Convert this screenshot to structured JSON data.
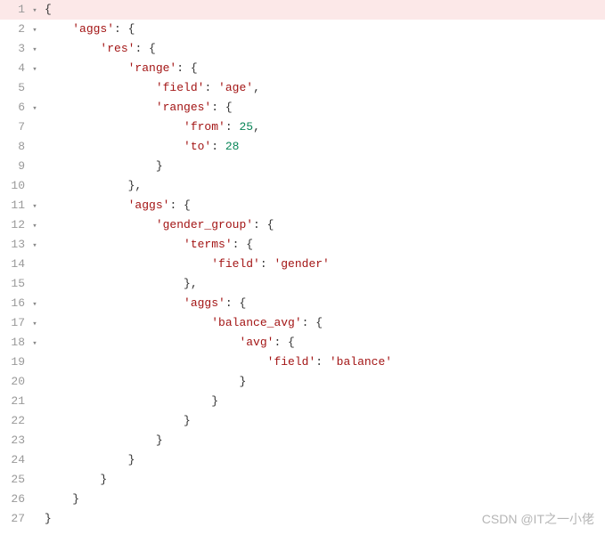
{
  "watermark": "CSDN @IT之一小佬",
  "lines": [
    {
      "num": "1",
      "fold": "▾",
      "hl": true,
      "indent": "",
      "tokens": [
        [
          "punct",
          "{"
        ]
      ]
    },
    {
      "num": "2",
      "fold": "▾",
      "hl": false,
      "indent": "    ",
      "tokens": [
        [
          "key",
          "'aggs'"
        ],
        [
          "punct",
          ": {"
        ]
      ]
    },
    {
      "num": "3",
      "fold": "▾",
      "hl": false,
      "indent": "        ",
      "tokens": [
        [
          "key",
          "'res'"
        ],
        [
          "punct",
          ": {"
        ]
      ]
    },
    {
      "num": "4",
      "fold": "▾",
      "hl": false,
      "indent": "            ",
      "tokens": [
        [
          "key",
          "'range'"
        ],
        [
          "punct",
          ": {"
        ]
      ]
    },
    {
      "num": "5",
      "fold": "",
      "hl": false,
      "indent": "                ",
      "tokens": [
        [
          "key",
          "'field'"
        ],
        [
          "punct",
          ": "
        ],
        [
          "key",
          "'age'"
        ],
        [
          "punct",
          ","
        ]
      ]
    },
    {
      "num": "6",
      "fold": "▾",
      "hl": false,
      "indent": "                ",
      "tokens": [
        [
          "key",
          "'ranges'"
        ],
        [
          "punct",
          ": {"
        ]
      ]
    },
    {
      "num": "7",
      "fold": "",
      "hl": false,
      "indent": "                    ",
      "tokens": [
        [
          "key",
          "'from'"
        ],
        [
          "punct",
          ": "
        ],
        [
          "num",
          "25"
        ],
        [
          "punct",
          ","
        ]
      ]
    },
    {
      "num": "8",
      "fold": "",
      "hl": false,
      "indent": "                    ",
      "tokens": [
        [
          "key",
          "'to'"
        ],
        [
          "punct",
          ": "
        ],
        [
          "num",
          "28"
        ]
      ]
    },
    {
      "num": "9",
      "fold": "",
      "hl": false,
      "indent": "                ",
      "tokens": [
        [
          "punct",
          "}"
        ]
      ]
    },
    {
      "num": "10",
      "fold": "",
      "hl": false,
      "indent": "            ",
      "tokens": [
        [
          "punct",
          "},"
        ]
      ]
    },
    {
      "num": "11",
      "fold": "▾",
      "hl": false,
      "indent": "            ",
      "tokens": [
        [
          "key",
          "'aggs'"
        ],
        [
          "punct",
          ": {"
        ]
      ]
    },
    {
      "num": "12",
      "fold": "▾",
      "hl": false,
      "indent": "                ",
      "tokens": [
        [
          "key",
          "'gender_group'"
        ],
        [
          "punct",
          ": {"
        ]
      ]
    },
    {
      "num": "13",
      "fold": "▾",
      "hl": false,
      "indent": "                    ",
      "tokens": [
        [
          "key",
          "'terms'"
        ],
        [
          "punct",
          ": {"
        ]
      ]
    },
    {
      "num": "14",
      "fold": "",
      "hl": false,
      "indent": "                        ",
      "tokens": [
        [
          "key",
          "'field'"
        ],
        [
          "punct",
          ": "
        ],
        [
          "key",
          "'gender'"
        ]
      ]
    },
    {
      "num": "15",
      "fold": "",
      "hl": false,
      "indent": "                    ",
      "tokens": [
        [
          "punct",
          "},"
        ]
      ]
    },
    {
      "num": "16",
      "fold": "▾",
      "hl": false,
      "indent": "                    ",
      "tokens": [
        [
          "key",
          "'aggs'"
        ],
        [
          "punct",
          ": {"
        ]
      ]
    },
    {
      "num": "17",
      "fold": "▾",
      "hl": false,
      "indent": "                        ",
      "tokens": [
        [
          "key",
          "'balance_avg'"
        ],
        [
          "punct",
          ": {"
        ]
      ]
    },
    {
      "num": "18",
      "fold": "▾",
      "hl": false,
      "indent": "                            ",
      "tokens": [
        [
          "key",
          "'avg'"
        ],
        [
          "punct",
          ": {"
        ]
      ]
    },
    {
      "num": "19",
      "fold": "",
      "hl": false,
      "indent": "                                ",
      "tokens": [
        [
          "key",
          "'field'"
        ],
        [
          "punct",
          ": "
        ],
        [
          "key",
          "'balance'"
        ]
      ]
    },
    {
      "num": "20",
      "fold": "",
      "hl": false,
      "indent": "                            ",
      "tokens": [
        [
          "punct",
          "}"
        ]
      ]
    },
    {
      "num": "21",
      "fold": "",
      "hl": false,
      "indent": "                        ",
      "tokens": [
        [
          "punct",
          "}"
        ]
      ]
    },
    {
      "num": "22",
      "fold": "",
      "hl": false,
      "indent": "                    ",
      "tokens": [
        [
          "punct",
          "}"
        ]
      ]
    },
    {
      "num": "23",
      "fold": "",
      "hl": false,
      "indent": "                ",
      "tokens": [
        [
          "punct",
          "}"
        ]
      ]
    },
    {
      "num": "24",
      "fold": "",
      "hl": false,
      "indent": "            ",
      "tokens": [
        [
          "punct",
          "}"
        ]
      ]
    },
    {
      "num": "25",
      "fold": "",
      "hl": false,
      "indent": "        ",
      "tokens": [
        [
          "punct",
          "}"
        ]
      ]
    },
    {
      "num": "26",
      "fold": "",
      "hl": false,
      "indent": "    ",
      "tokens": [
        [
          "punct",
          "}"
        ]
      ]
    },
    {
      "num": "27",
      "fold": "",
      "hl": false,
      "indent": "",
      "tokens": [
        [
          "punct",
          "}"
        ]
      ]
    }
  ]
}
